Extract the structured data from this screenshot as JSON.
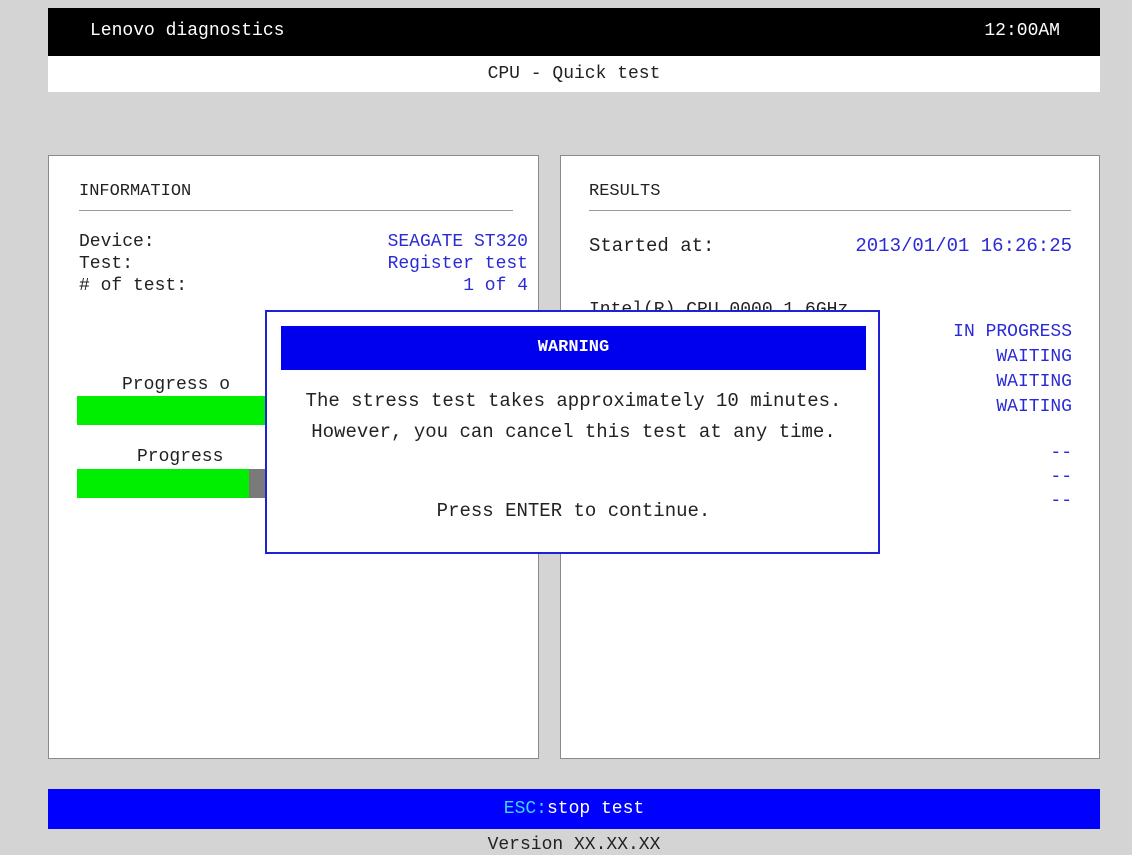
{
  "header": {
    "app_title": "Lenovo diagnostics",
    "clock": "12:00AM",
    "subtitle": "CPU - Quick test"
  },
  "info_panel": {
    "heading": "INFORMATION",
    "rows": [
      {
        "label": "Device:",
        "value": "SEAGATE ST320"
      },
      {
        "label": "Test:",
        "value": "Register test"
      },
      {
        "label": "# of test:",
        "value": "1 of 4"
      }
    ],
    "progress1_label": "Progress o",
    "progress1_fraction": 1.0,
    "progress2_label": "Progress",
    "progress2_fraction": 0.4
  },
  "results_panel": {
    "heading": "RESULTS",
    "started_label": "Started at:",
    "started_value": "2013/01/01 16:26:25",
    "device_line": "Intel(R) CPU 0000 1.6GHz",
    "statuses": [
      "IN PROGRESS",
      "WAITING",
      "WAITING",
      "WAITING"
    ],
    "dashes": [
      "--",
      "--",
      "--"
    ]
  },
  "dialog": {
    "title": "WARNING",
    "message": "The stress test takes approximately 10 minutes. However, you can cancel this test at any time.",
    "cta": "Press ENTER to continue."
  },
  "footer": {
    "key": "ESC:",
    "action": "stop test",
    "version": "Version XX.XX.XX"
  },
  "colors": {
    "accent_blue": "#0000ff",
    "value_blue": "#2a2ad6",
    "progress_green": "#00ef00"
  }
}
